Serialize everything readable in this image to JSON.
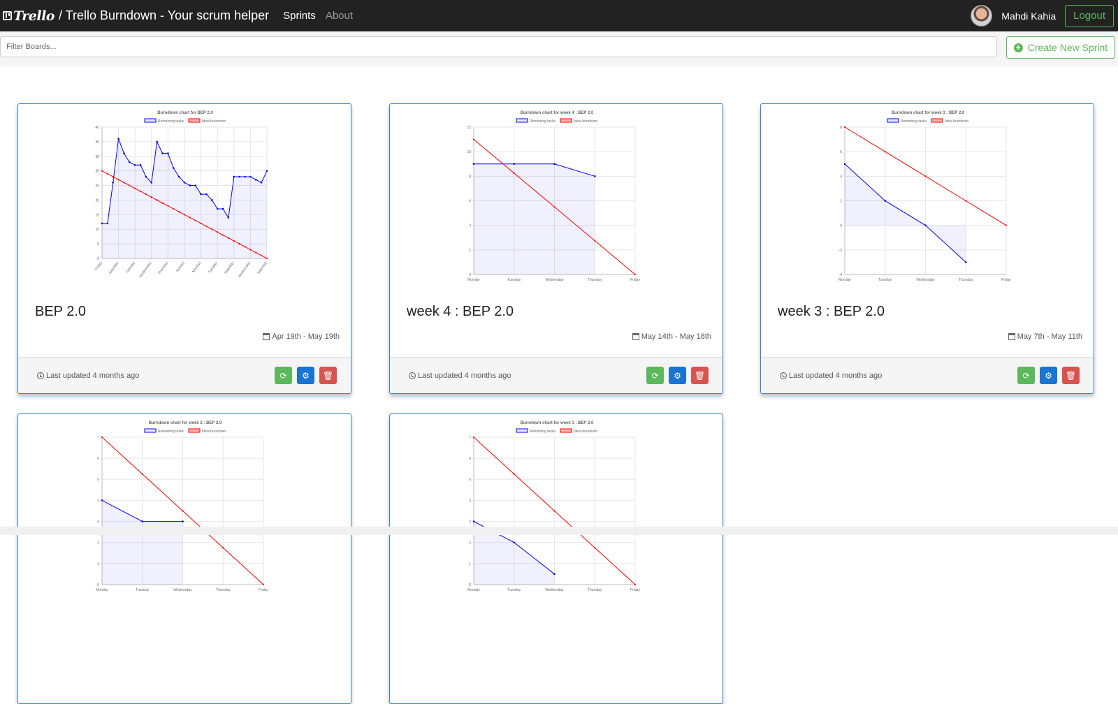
{
  "navbar": {
    "logo_text": "Trello",
    "title": "/ Trello Burndown - Your scrum helper",
    "links": [
      {
        "label": "Sprints",
        "active": true
      },
      {
        "label": "About",
        "active": false
      }
    ],
    "user_name": "Mahdi Kahia",
    "logout_label": "Logout"
  },
  "toolbar": {
    "filter_placeholder": "Filter Boards...",
    "create_label": "Create New Sprint"
  },
  "colors": {
    "remaining": "#0000ff",
    "ideal": "#ff0000",
    "card_border": "#3b7fe0",
    "refresh": "#5cb85c",
    "settings": "#1a74d1",
    "delete": "#d9534f"
  },
  "cards": [
    {
      "name": "BEP 2.0",
      "dates": "Apr 19th - May 19th",
      "updated": "Last updated 4 months ago",
      "actions": {
        "refresh_icon": "refresh-icon",
        "settings_icon": "cog-icon",
        "delete_icon": "trash-icon"
      }
    },
    {
      "name": "week 4 : BEP 2.0",
      "dates": "May 14th - May 18th",
      "updated": "Last updated 4 months ago",
      "actions": {
        "refresh_icon": "refresh-icon",
        "settings_icon": "cog-icon",
        "delete_icon": "trash-icon"
      }
    },
    {
      "name": "week 3 : BEP 2.0",
      "dates": "May 7th - May 11th",
      "updated": "Last updated 4 months ago",
      "actions": {
        "refresh_icon": "refresh-icon",
        "settings_icon": "cog-icon",
        "delete_icon": "trash-icon"
      }
    },
    {
      "name": "",
      "dates": "",
      "updated": ""
    },
    {
      "name": "",
      "dates": "",
      "updated": ""
    }
  ],
  "chart_data": [
    {
      "type": "line",
      "title": "Burndown chart for BEP 2.0",
      "legend": [
        "Remaining tasks",
        "Ideal burndown"
      ],
      "x": [
        "Friday",
        "Saturday",
        "Sunday",
        "Monday",
        "Tuesday",
        "Wednesday",
        "Thursday",
        "Friday",
        "Saturday",
        "Sunday",
        "Monday",
        "Tuesday",
        "Wednesday",
        "Thursday",
        "Friday",
        "Saturday",
        "Sunday",
        "Monday",
        "Tuesday",
        "Wednesday",
        "Thursday",
        "Friday",
        "Saturday",
        "Sunday",
        "Monday",
        "Tuesday",
        "Wednesday",
        "Thursday",
        "Friday",
        "Saturday",
        "Sunday"
      ],
      "x_tick_labels": [
        "Friday",
        "Saturday",
        "Tuesday",
        "Wednesday",
        "Thursday",
        "Sunday",
        "Monday",
        "Tuesday",
        "Saturday",
        "Wednesday",
        "Saturday"
      ],
      "series": [
        {
          "name": "Remaining tasks",
          "values": [
            12,
            12,
            26,
            41,
            36,
            33,
            32,
            32,
            28,
            26,
            40,
            36,
            36,
            31,
            28,
            26,
            25,
            25,
            22,
            22,
            20,
            17,
            17,
            14,
            28,
            28,
            28,
            28,
            27,
            26,
            30
          ]
        },
        {
          "name": "Ideal burndown",
          "values": [
            30,
            29,
            28,
            27,
            26,
            25,
            24,
            23,
            22,
            21,
            20,
            19,
            18,
            17,
            16,
            15,
            14,
            13,
            12,
            11,
            10,
            9,
            8,
            7,
            6,
            5,
            4,
            3,
            2,
            1,
            0
          ]
        }
      ],
      "ylim": [
        0,
        45
      ],
      "yticks": [
        0,
        5,
        10,
        15,
        20,
        25,
        30,
        35,
        40,
        45
      ],
      "grid": true,
      "legend_position": "top"
    },
    {
      "type": "line",
      "title": "Burndown chart for week 4 : BEP 2.0",
      "legend": [
        "Remaining tasks",
        "Ideal burndown"
      ],
      "x": [
        "Monday",
        "Tuesday",
        "Wednesday",
        "Thursday",
        "Friday"
      ],
      "x_tick_labels": [
        "Monday",
        "Tuesday",
        "Wednesday",
        "Thursday",
        "Friday"
      ],
      "series": [
        {
          "name": "Remaining tasks",
          "values": [
            9,
            9,
            9,
            8
          ]
        },
        {
          "name": "Ideal burndown",
          "values": [
            11,
            8.25,
            5.5,
            2.75,
            0
          ]
        }
      ],
      "ylim": [
        0,
        12
      ],
      "yticks": [
        0,
        2,
        4,
        6,
        8,
        10,
        12
      ],
      "grid": true,
      "legend_position": "top"
    },
    {
      "type": "line",
      "title": "Burndown chart for week 3 : BEP 2.0",
      "legend": [
        "Remaining tasks",
        "Ideal burndown"
      ],
      "x": [
        "Monday",
        "Tuesday",
        "Wednesday",
        "Thursday",
        "Friday"
      ],
      "x_tick_labels": [
        "Monday",
        "Tuesday",
        "Wednesday",
        "Thursday",
        "Friday"
      ],
      "series": [
        {
          "name": "Remaining tasks",
          "values": [
            5,
            2,
            0,
            -3
          ]
        },
        {
          "name": "Ideal burndown",
          "values": [
            8,
            6,
            4,
            2,
            0
          ]
        }
      ],
      "ylim": [
        -4,
        8
      ],
      "yticks": [
        -4,
        -2,
        0,
        2,
        4,
        6,
        8
      ],
      "grid": true,
      "legend_position": "top"
    },
    {
      "type": "line",
      "title": "Burndown chart for week 2 : BEP 2.0",
      "legend": [
        "Remaining tasks",
        "Ideal burndown"
      ],
      "x": [
        "Monday",
        "Tuesday",
        "Wednesday",
        "Thursday",
        "Friday"
      ],
      "x_tick_labels": [
        "Monday",
        "Tuesday",
        "Wednesday",
        "Thursday",
        "Friday"
      ],
      "series": [
        {
          "name": "Remaining tasks",
          "values": [
            4,
            3,
            3
          ]
        },
        {
          "name": "Ideal burndown",
          "values": [
            7,
            5.25,
            3.5,
            1.75,
            0
          ]
        }
      ],
      "ylim": [
        0,
        7
      ],
      "yticks": [
        0,
        1,
        2,
        3,
        4,
        5,
        6,
        7
      ],
      "grid": true,
      "legend_position": "top"
    },
    {
      "type": "line",
      "title": "Burndown chart for week 1 : BEP 2.0",
      "legend": [
        "Remaining tasks",
        "Ideal burndown"
      ],
      "x": [
        "Monday",
        "Tuesday",
        "Wednesday",
        "Thursday",
        "Friday"
      ],
      "x_tick_labels": [
        "Monday",
        "Tuesday",
        "Wednesday",
        "Thursday",
        "Friday"
      ],
      "series": [
        {
          "name": "Remaining tasks",
          "values": [
            3,
            2,
            0.5
          ]
        },
        {
          "name": "Ideal burndown",
          "values": [
            7,
            5.25,
            3.5,
            1.75,
            0
          ]
        }
      ],
      "ylim": [
        0,
        7
      ],
      "yticks": [
        0,
        1,
        2,
        3,
        4,
        5,
        6,
        7
      ],
      "grid": true,
      "legend_position": "top"
    }
  ]
}
